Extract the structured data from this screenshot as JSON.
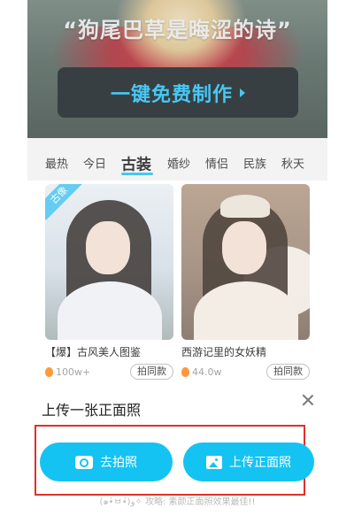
{
  "hero": {
    "slogan": "“狗尾巴草是晦涩的诗”",
    "cta_label": "一键免费制作"
  },
  "tabs": [
    "最热",
    "今日",
    "古装",
    "婚纱",
    "情侣",
    "民族",
    "秋天"
  ],
  "active_tab": "古装",
  "cards": [
    {
      "badge": "古像",
      "title": "【爆】古风美人图鉴",
      "count": "100w+",
      "button": "拍同款"
    },
    {
      "badge": "",
      "title": "西游记里的女妖精",
      "count": "44.0w",
      "button": "拍同款"
    }
  ],
  "sheet": {
    "title": "上传一张正面照",
    "photo_button": "去拍照",
    "upload_button": "上传正面照",
    "tip": "(๑•̀ㅂ•́)و✧ 攻略: 素颜正面照效果最佳!!"
  },
  "colors": {
    "accent": "#15c3f2",
    "highlight": "#e0302a",
    "fire": "#ff8a23"
  }
}
